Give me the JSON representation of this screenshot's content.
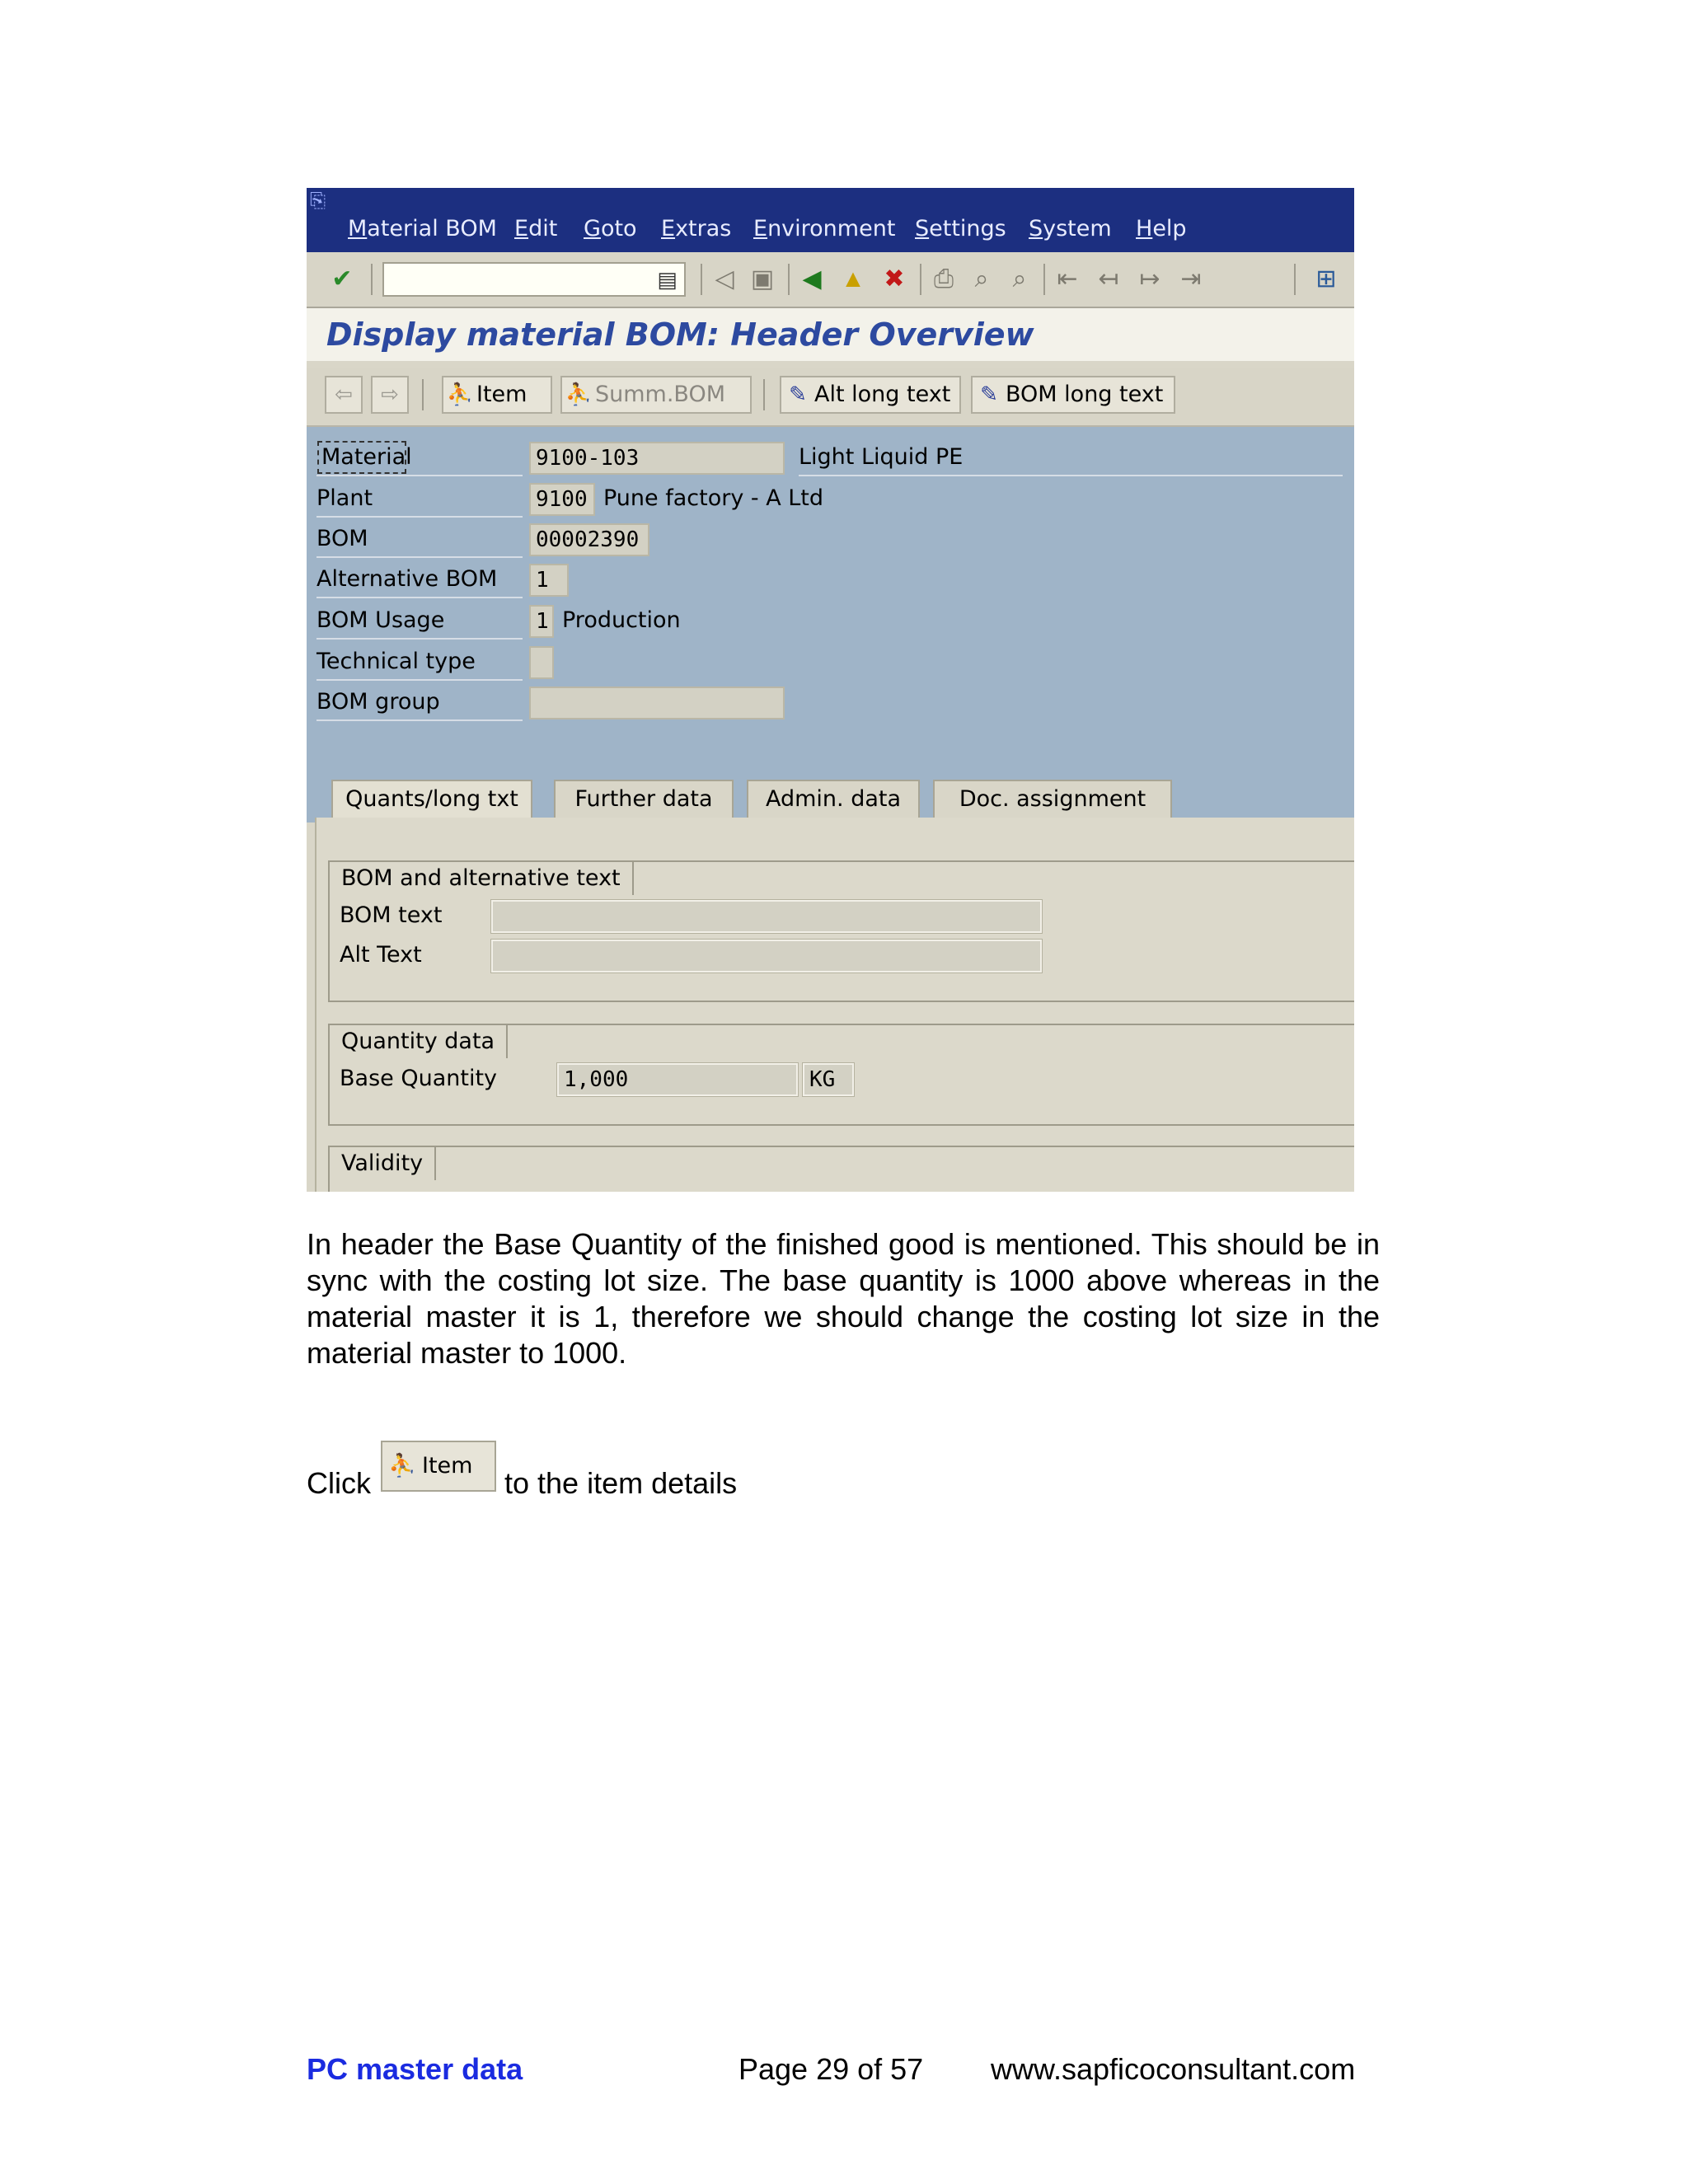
{
  "menubar": {
    "items": [
      "Material BOM",
      "Edit",
      "Goto",
      "Extras",
      "Environment",
      "Settings",
      "System",
      "Help"
    ]
  },
  "toolbar": {
    "icons": [
      "enter-icon",
      "command-field",
      "back-arrow-icon",
      "save-icon",
      "back-icon",
      "exit-icon",
      "cancel-icon",
      "print-icon",
      "find-icon",
      "find-next-icon",
      "first-page-icon",
      "prev-page-icon",
      "next-page-icon",
      "last-page-icon",
      "layout-icon"
    ]
  },
  "title": "Display material BOM: Header Overview",
  "app_toolbar": {
    "item_label": "Item",
    "summ_bom_label": "Summ.BOM",
    "alt_long_text_label": "Alt long text",
    "bom_long_text_label": "BOM long text"
  },
  "header": {
    "material_label": "Material",
    "material_value": "9100-103",
    "material_desc": "Light Liquid PE",
    "plant_label": "Plant",
    "plant_value": "9100",
    "plant_desc": "Pune factory -  A Ltd",
    "bom_label": "BOM",
    "bom_value": "00002390",
    "alt_bom_label": "Alternative BOM",
    "alt_bom_value": "1",
    "bom_usage_label": "BOM Usage",
    "bom_usage_value": "1",
    "bom_usage_desc": "Production",
    "tech_type_label": "Technical type",
    "bom_group_label": "BOM group"
  },
  "tabs": [
    "Quants/long txt",
    "Further data",
    "Admin. data",
    "Doc. assignment"
  ],
  "groups": {
    "text_title": "BOM and alternative text",
    "bom_text_label": "BOM text",
    "alt_text_label": "Alt Text",
    "quantity_title": "Quantity data",
    "base_qty_label": "Base Quantity",
    "base_qty_value": "1,000",
    "base_qty_unit": "KG",
    "validity_title": "Validity"
  },
  "document": {
    "paragraph": "In header the Base Quantity of the finished good is mentioned. This should be in sync with the costing lot size. The base quantity is 1000 above whereas in the material master it is 1, therefore we should change the costing lot size in the material master to 1000.",
    "click_word": "Click",
    "click_button_label": "Item",
    "click_rest": "to the item details"
  },
  "footer": {
    "left": "PC master data",
    "center": "Page 29 of 57",
    "right": "www.sapficoconsultant.com"
  },
  "colors": {
    "menubar": "#1c2f80",
    "header_area": "#9fb4c8",
    "title": "#2d4aa0",
    "footer_link": "#1a2be0"
  }
}
